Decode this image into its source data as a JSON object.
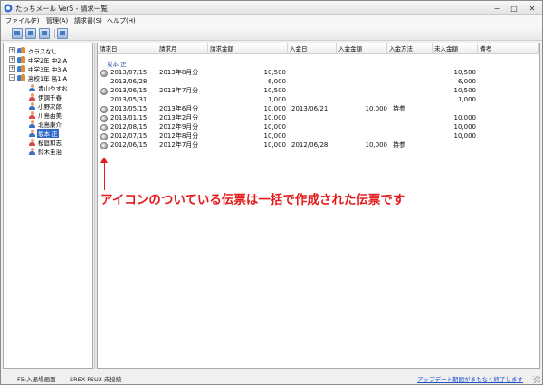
{
  "window": {
    "title": "たっちメール Ver5 - 請求一覧",
    "controls": {
      "minimize": "−",
      "maximize": "□",
      "close": "✕"
    }
  },
  "menu": [
    "ファイル(F)",
    "管理(A)",
    "請求書(S)",
    "ヘルプ(H)"
  ],
  "toolbar": {
    "buttons": [
      "grid-icon",
      "refresh-icon",
      "print-icon",
      "export-icon"
    ]
  },
  "tree": {
    "groups": [
      {
        "label": "クラスなし",
        "toggle": "+"
      },
      {
        "label": "中学2年  中2-A",
        "toggle": "+"
      },
      {
        "label": "中学3年  中3-A",
        "toggle": "+"
      },
      {
        "label": "高校1年  高1-A",
        "toggle": "−"
      }
    ],
    "students": [
      {
        "name": "青山やすお",
        "icon": "male"
      },
      {
        "name": "伊調千春",
        "icon": "female"
      },
      {
        "name": "小野次郎",
        "icon": "male"
      },
      {
        "name": "川島由美",
        "icon": "female"
      },
      {
        "name": "北島康介",
        "icon": "male"
      },
      {
        "name": "坂本  正",
        "icon": "male",
        "selected": true
      },
      {
        "name": "桜庭和志",
        "icon": "female"
      },
      {
        "name": "鈴木圭治",
        "icon": "male"
      }
    ]
  },
  "grid": {
    "columns": [
      "請求日",
      "請求月",
      "請求金額",
      "入金日",
      "入金金額",
      "入金方法",
      "未入金額",
      "備考"
    ],
    "group_label": "坂本  正",
    "rows": [
      {
        "date": "2013/07/15",
        "month": "2013年8月分",
        "amount": "10,500",
        "paid_date": "",
        "paid_amount": "",
        "method": "",
        "unpaid": "10,500",
        "note": "",
        "batch": true
      },
      {
        "date": "2013/06/28",
        "month": "",
        "amount": "6,000",
        "paid_date": "",
        "paid_amount": "",
        "method": "",
        "unpaid": "6,000",
        "note": "",
        "batch": false
      },
      {
        "date": "2013/06/15",
        "month": "2013年7月分",
        "amount": "10,500",
        "paid_date": "",
        "paid_amount": "",
        "method": "",
        "unpaid": "10,500",
        "note": "",
        "batch": true
      },
      {
        "date": "2013/05/31",
        "month": "",
        "amount": "1,000",
        "paid_date": "",
        "paid_amount": "",
        "method": "",
        "unpaid": "1,000",
        "note": "",
        "batch": false
      },
      {
        "date": "2013/05/15",
        "month": "2013年6月分",
        "amount": "10,000",
        "paid_date": "2013/06/21",
        "paid_amount": "10,000",
        "method": "持参",
        "unpaid": "",
        "note": "",
        "batch": true
      },
      {
        "date": "2013/01/15",
        "month": "2013年2月分",
        "amount": "10,000",
        "paid_date": "",
        "paid_amount": "",
        "method": "",
        "unpaid": "10,000",
        "note": "",
        "batch": true
      },
      {
        "date": "2012/08/15",
        "month": "2012年9月分",
        "amount": "10,000",
        "paid_date": "",
        "paid_amount": "",
        "method": "",
        "unpaid": "10,000",
        "note": "",
        "batch": true
      },
      {
        "date": "2012/07/15",
        "month": "2012年8月分",
        "amount": "10,000",
        "paid_date": "",
        "paid_amount": "",
        "method": "",
        "unpaid": "10,000",
        "note": "",
        "batch": true
      },
      {
        "date": "2012/06/15",
        "month": "2012年7月分",
        "amount": "10,000",
        "paid_date": "2012/06/28",
        "paid_amount": "10,000",
        "method": "持参",
        "unpaid": "",
        "note": "",
        "batch": true
      }
    ]
  },
  "annotation": {
    "text": "アイコンのついている伝票は一括で作成された伝票です",
    "color": "#e21c1c"
  },
  "status": {
    "shortcut": "F5:入退場画面",
    "device": "SREX-FSU2 未接続",
    "update_link": "アップデート期間がまもなく終了します"
  }
}
